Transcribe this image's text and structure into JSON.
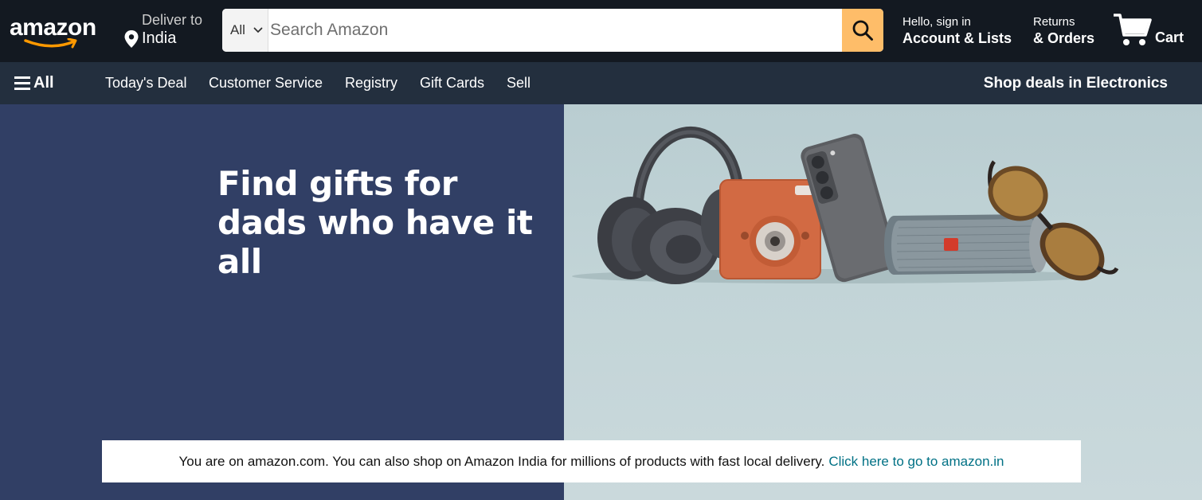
{
  "header": {
    "logo_text": "amazon",
    "deliver": {
      "label": "Deliver to",
      "country": "India"
    },
    "search": {
      "category": "All",
      "placeholder": "Search Amazon",
      "value": ""
    },
    "account": {
      "greeting": "Hello, sign in",
      "label": "Account & Lists"
    },
    "orders": {
      "line1": "Returns",
      "line2": "& Orders"
    },
    "cart": {
      "label": "Cart"
    }
  },
  "subnav": {
    "all_label": "All",
    "links": [
      "Today's Deal",
      "Customer Service",
      "Registry",
      "Gift Cards",
      "Sell"
    ],
    "promo": "Shop deals in Electronics"
  },
  "hero": {
    "headline_line1": "Find gifts for",
    "headline_line2": "dads who have it all",
    "products": [
      "headphones",
      "instant-camera",
      "smartphone",
      "speaker",
      "sunglasses"
    ]
  },
  "notice": {
    "text": "You are on amazon.com. You can also shop on Amazon India for millions of products with fast local delivery.",
    "link": "Click here to go to amazon.in"
  },
  "colors": {
    "header_bg": "#131921",
    "subnav_bg": "#232f3e",
    "search_button": "#febd69",
    "logo_smile": "#ff9900",
    "hero_left": "#313f65",
    "link": "#007185"
  }
}
